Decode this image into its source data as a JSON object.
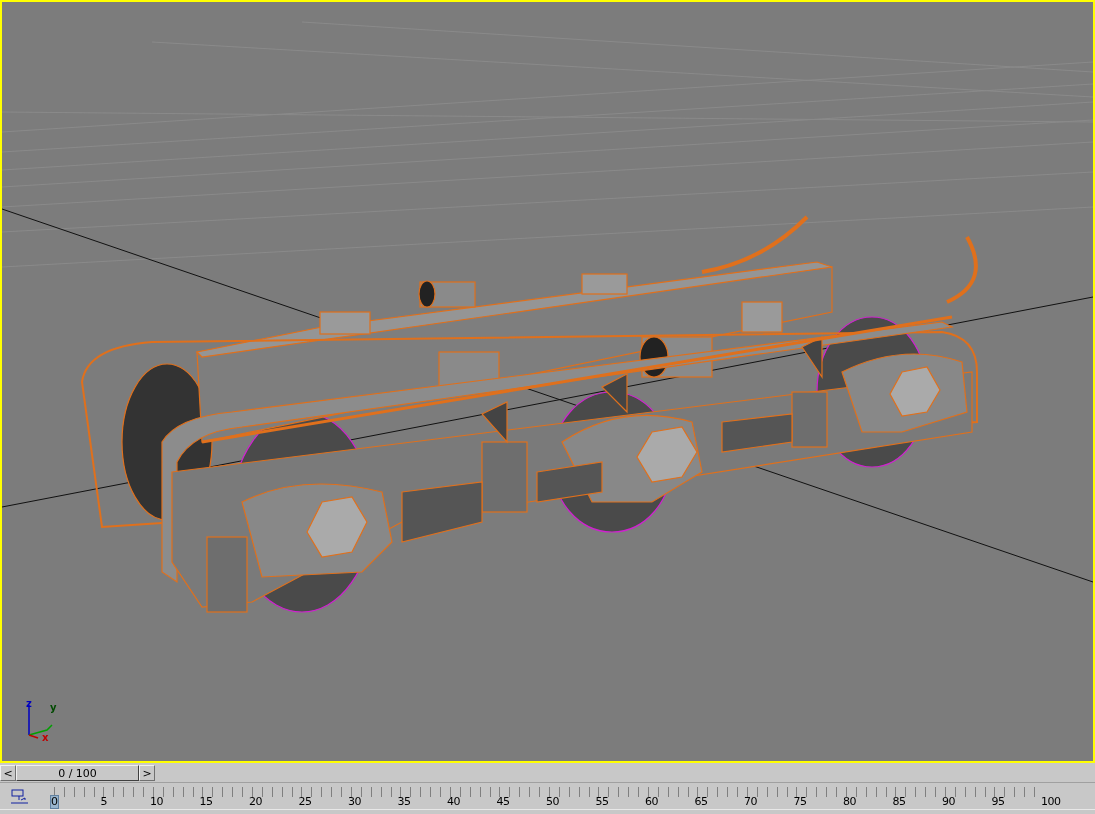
{
  "viewport": {
    "active": true,
    "gizmo": {
      "axes": [
        "z",
        "y",
        "x"
      ]
    }
  },
  "time_slider": {
    "prev": "<",
    "label": "0 / 100",
    "next": ">",
    "level": 0
  },
  "track_bar": {
    "labels": [
      {
        "text": "0",
        "selected": true
      },
      {
        "text": "5",
        "selected": false
      },
      {
        "text": "10",
        "selected": false
      },
      {
        "text": "15",
        "selected": false
      },
      {
        "text": "20",
        "selected": false
      },
      {
        "text": "25",
        "selected": false
      },
      {
        "text": "30",
        "selected": false
      },
      {
        "text": "35",
        "selected": false
      },
      {
        "text": "40",
        "selected": false
      },
      {
        "text": "45",
        "selected": false
      },
      {
        "text": "50",
        "selected": false
      },
      {
        "text": "55",
        "selected": false
      },
      {
        "text": "60",
        "selected": false
      },
      {
        "text": "65",
        "selected": false
      },
      {
        "text": "70",
        "selected": false
      },
      {
        "text": "75",
        "selected": false
      },
      {
        "text": "80",
        "selected": false
      },
      {
        "text": "85",
        "selected": false
      },
      {
        "text": "90",
        "selected": false
      },
      {
        "text": "95",
        "selected": false
      },
      {
        "text": "100",
        "selected": false
      }
    ]
  }
}
